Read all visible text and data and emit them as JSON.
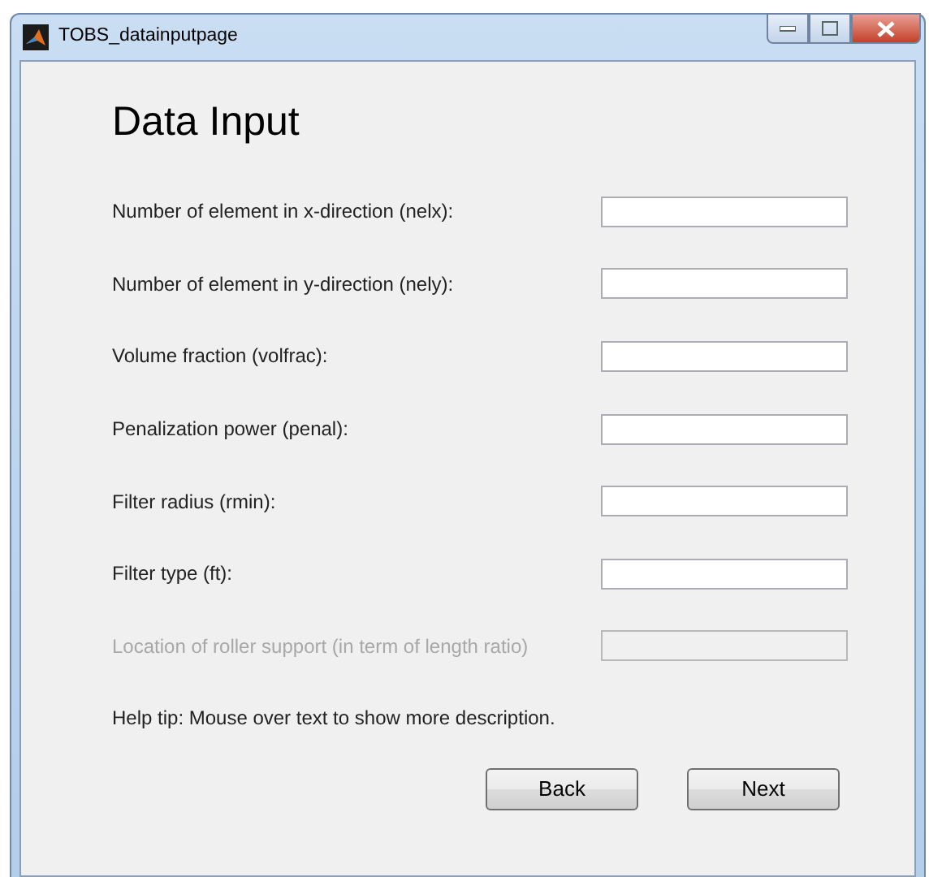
{
  "window": {
    "title": "TOBS_datainputpage"
  },
  "heading": "Data Input",
  "fields": [
    {
      "label": "Number of element in x-direction (nelx):",
      "disabled": false
    },
    {
      "label": "Number of element in y-direction (nely):",
      "disabled": false
    },
    {
      "label": "Volume fraction (volfrac):",
      "disabled": false
    },
    {
      "label": "Penalization power (penal):",
      "disabled": false
    },
    {
      "label": "Filter radius (rmin):",
      "disabled": false
    },
    {
      "label": "Filter type (ft):",
      "disabled": false
    },
    {
      "label": "Location of roller support (in term of length ratio)",
      "disabled": true
    }
  ],
  "help_text": "Help tip: Mouse over text to show more description.",
  "buttons": [
    "Back",
    "Next"
  ]
}
